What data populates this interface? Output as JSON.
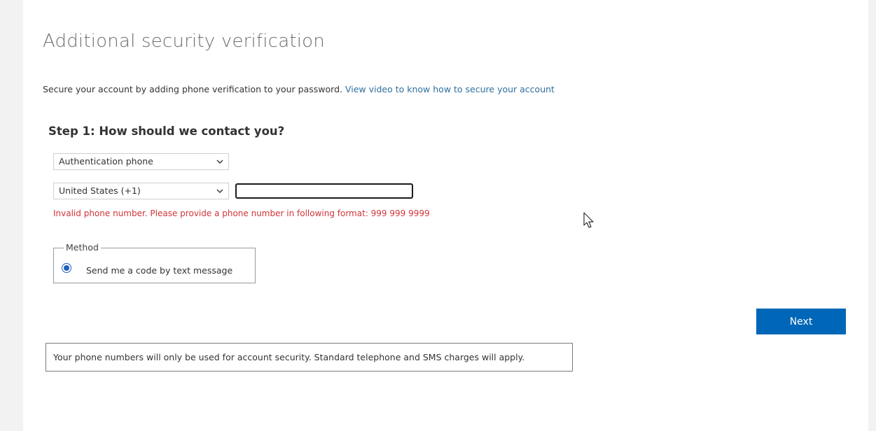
{
  "header": {
    "title": "Additional security verification"
  },
  "intro": {
    "text": "Secure your account by adding phone verification to your password.",
    "link_text": "View video to know how to secure your account"
  },
  "step1": {
    "title": "Step 1: How should we contact you?",
    "contact_method": {
      "selected": "Authentication phone"
    },
    "country": {
      "selected": "United States (+1)"
    },
    "phone": {
      "value": ""
    },
    "error": "Invalid phone number. Please provide a phone number in following format: 999 999 9999",
    "method": {
      "legend": "Method",
      "options": [
        {
          "label": "Send me a code by text message",
          "selected": true
        }
      ]
    }
  },
  "actions": {
    "next_label": "Next"
  },
  "notice": {
    "text": "Your phone numbers will only be used for account security. Standard telephone and SMS charges will apply."
  },
  "icons": {
    "dropdown": "chevron-down-icon",
    "pointer": "mouse-pointer-icon"
  },
  "colors": {
    "primary_button": "#0067b8",
    "error": "#d13438",
    "link": "#2f6f9f",
    "radio": "#1f5fbf"
  }
}
